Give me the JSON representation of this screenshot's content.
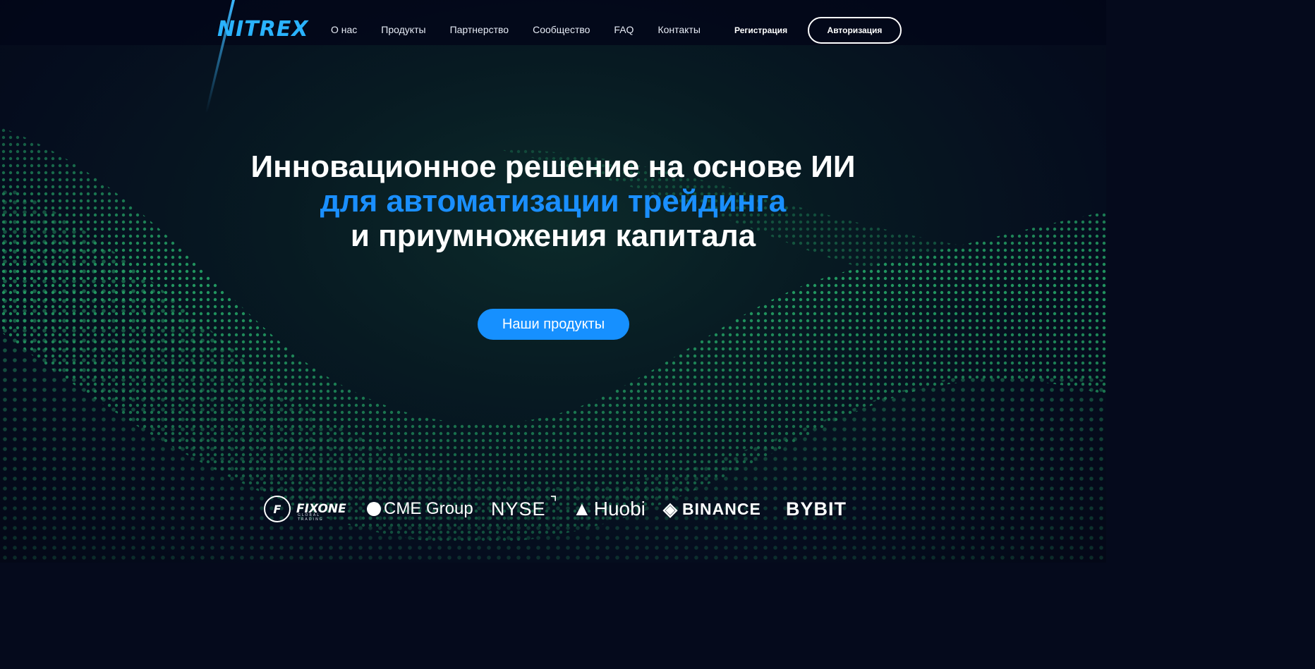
{
  "header": {
    "logo_text": "NITREX",
    "nav": [
      "О нас",
      "Продукты",
      "Партнерство",
      "Сообщество",
      "FAQ",
      "Контакты"
    ],
    "register_label": "Регистрация",
    "login_label": "Авторизация"
  },
  "hero": {
    "line1": "Инновационное решение на основе ИИ",
    "line2": "для автоматизации трейдинга",
    "line3": "и приумножения капитала",
    "cta_label": "Наши продукты"
  },
  "partners": {
    "fixone": "FIXONE",
    "fixone_sub": "GLOBAL TRADING",
    "cme": "CME Group",
    "nyse": "NYSE",
    "huobi": "Huobi",
    "binance": "BINANCE",
    "bybit": "BYBIT"
  },
  "colors": {
    "accent": "#1690ff",
    "hero_highlight": "#1a8fff",
    "background": "#050a1c",
    "particles": "#2fd67f"
  }
}
